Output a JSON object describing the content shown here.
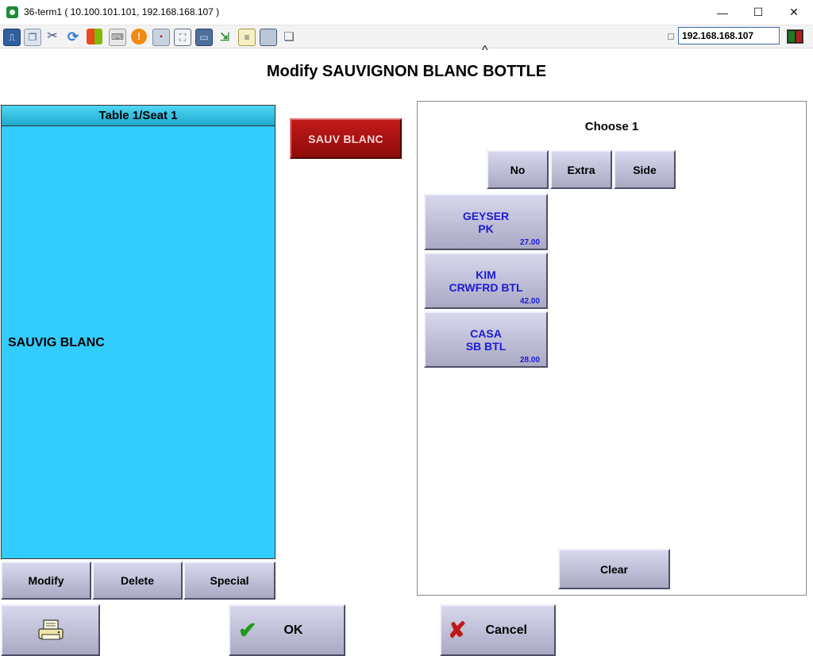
{
  "window": {
    "title": "36-term1 ( 10.100.101.101, 192.168.168.107 )",
    "minimize_glyph": "—",
    "maximize_glyph": "☐",
    "close_glyph": "✕"
  },
  "toolbar": {
    "icons": [
      "monitor-icon",
      "copy-windows-icon",
      "tools-icon",
      "refresh-icon",
      "windows-logo-icon",
      "keyboard-icon",
      "alert-icon",
      "network-icon",
      "fullscreen-icon",
      "display-icon",
      "transfer-icon",
      "notepad-icon",
      "resize-icon",
      "chat-icon"
    ],
    "ip_value": "192.168.168.107"
  },
  "page": {
    "caret": "^",
    "title": "Modify SAUVIGNON BLANC BOTTLE"
  },
  "order": {
    "header": "Table 1/Seat 1",
    "item": "SAUVIG BLANC",
    "buttons": {
      "modify": "Modify",
      "delete": "Delete",
      "special": "Special"
    }
  },
  "selected_item": {
    "label": "SAUV BLANC"
  },
  "modifiers": {
    "choose_label": "Choose 1",
    "options": {
      "no": "No",
      "extra": "Extra",
      "side": "Side"
    },
    "items": [
      {
        "line1": "GEYSER",
        "line2": "PK",
        "price": "27.00"
      },
      {
        "line1": "KIM",
        "line2": "CRWFRD BTL",
        "price": "42.00"
      },
      {
        "line1": "CASA",
        "line2": "SB BTL",
        "price": "28.00"
      }
    ],
    "clear": "Clear"
  },
  "footer": {
    "ok": "OK",
    "cancel": "Cancel"
  },
  "colors": {
    "order_panel": "#33ccff",
    "selected_item": "#a91212",
    "modifier_text": "#1b1bd6"
  }
}
